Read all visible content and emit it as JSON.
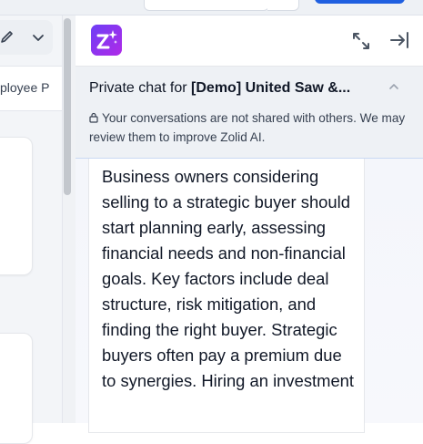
{
  "left_pane": {
    "row_label": "ployee P"
  },
  "chat": {
    "privacy_prefix": "Private chat for ",
    "chat_name": "[Demo] United Saw &...",
    "privacy_note": "Your conversations are not shared with others. We may review them to improve Zolid AI.",
    "message": "Business owners considering selling to a strategic buyer should start planning early, assessing financial needs and non-financial goals. Key factors include deal structure, risk mitigation, and finding the right buyer. Strategic buyers often pay a premium due to synergies. Hiring an investment"
  },
  "icons": {
    "logo": "zolid-ai-logo",
    "expand": "expand-icon",
    "dock": "dock-right-icon",
    "collapse": "chevron-up-icon",
    "lock": "lock-icon",
    "edit": "pencil-icon",
    "dropdown": "chevron-down-icon"
  },
  "colors": {
    "brand_gradient_start": "#6d3ef5",
    "brand_gradient_end": "#b02ae8",
    "primary_button": "#1f5fe0",
    "privacy_bg": "#eef1f5"
  }
}
